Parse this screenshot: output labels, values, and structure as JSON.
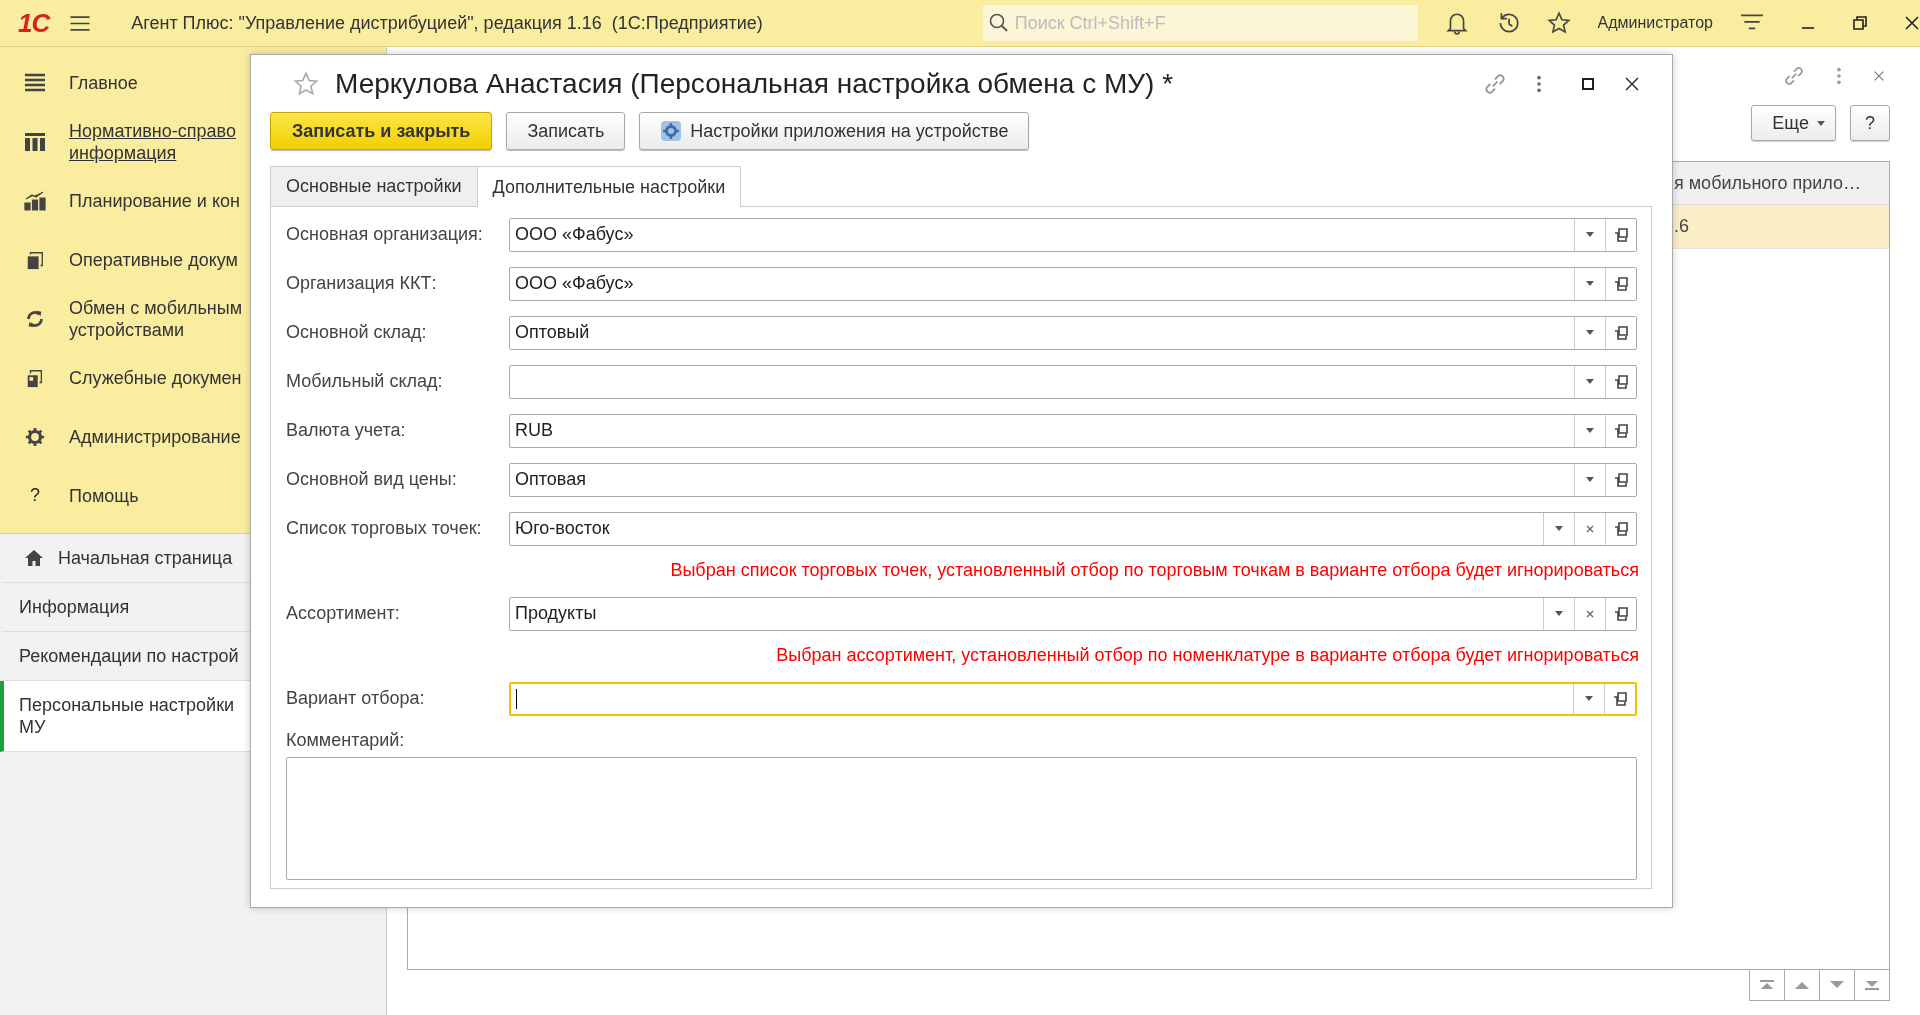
{
  "titlebar": {
    "logo": "1С",
    "title": "Агент Плюс: \"Управление дистрибуцией\", редакция 1.16  (1С:Предприятие)",
    "search": {
      "placeholder": "Поиск Ctrl+Shift+F"
    },
    "user": "Администратор"
  },
  "sidebar": {
    "sections": [
      {
        "lines": [
          "Главное"
        ],
        "kind": "lines",
        "link": false
      },
      {
        "lines": [
          "Нормативно-справо",
          "информация"
        ],
        "kind": "columns",
        "link": true
      },
      {
        "lines": [
          "Планирование и кон"
        ],
        "kind": "chart",
        "link": false
      },
      {
        "lines": [
          "Оперативные докум"
        ],
        "kind": "docs",
        "link": false
      },
      {
        "lines": [
          "Обмен с мобильным",
          "устройствами"
        ],
        "kind": "sync",
        "link": false
      },
      {
        "lines": [
          "Служебные докумен"
        ],
        "kind": "service",
        "link": false
      },
      {
        "lines": [
          "Администрирование"
        ],
        "kind": "gear",
        "link": false
      },
      {
        "lines": [
          "Помощь"
        ],
        "kind": "help",
        "glyph": "?",
        "link": false
      }
    ],
    "open_pages": [
      {
        "lines": [
          "Начальная страница"
        ],
        "kind": "home",
        "selected": false
      },
      {
        "lines": [
          "Информация"
        ],
        "kind": "plain",
        "selected": false
      },
      {
        "lines": [
          "Рекомендации по настрой"
        ],
        "kind": "plain",
        "selected": false
      },
      {
        "lines": [
          "Персональные настройки",
          "МУ"
        ],
        "kind": "plain",
        "selected": true
      }
    ]
  },
  "background_form": {
    "buttons": [
      {
        "label": "Еще",
        "kind": "menu"
      },
      {
        "label": "?",
        "kind": "plain"
      }
    ],
    "table": {
      "columns": [
        "я мобильного прило…"
      ],
      "rows": [
        {
          "cells": [
            ".6"
          ],
          "selected": true
        }
      ]
    }
  },
  "dialog": {
    "title": "Меркулова Анастасия (Персональная настройка обмена с МУ) *",
    "buttons": [
      {
        "label": "Записать и закрыть",
        "kind": "primary"
      },
      {
        "label": "Записать",
        "kind": "default"
      },
      {
        "label": "Настройки приложения на устройстве",
        "kind": "gear"
      }
    ],
    "tabs": [
      {
        "label": "Основные настройки",
        "selected": false
      },
      {
        "label": "Дополнительные настройки",
        "selected": true
      }
    ],
    "fields": [
      {
        "label": "Основная организация:",
        "value": "ООО «Фабус»",
        "clear_button": false,
        "focused": false
      },
      {
        "label": "Организация ККТ:",
        "value": "ООО «Фабус»",
        "clear_button": false,
        "focused": false
      },
      {
        "label": "Основной склад:",
        "value": "Оптовый",
        "clear_button": false,
        "focused": false
      },
      {
        "label": "Мобильный склад:",
        "clear_button": false,
        "focused": false
      },
      {
        "label": "Валюта учета:",
        "value": "RUB",
        "clear_button": false,
        "focused": false
      },
      {
        "label": "Основной вид цены:",
        "value": "Оптовая",
        "clear_button": false,
        "focused": false
      },
      {
        "label": "Список торговых точек:",
        "value": "Юго-восток",
        "clear_button": true,
        "focused": false,
        "warning": "Выбран список торговых точек, установленный отбор по торговым точкам в варианте отбора будет игнорироваться"
      },
      {
        "label": "Ассортимент:",
        "value": "Продукты",
        "clear_button": true,
        "focused": false,
        "warning": "Выбран ассортимент, установленный отбор по номенклатуре в варианте отбора будет игнорироваться"
      },
      {
        "label": "Вариант отбора:",
        "clear_button": false,
        "focused": true
      }
    ],
    "comment": {
      "label": "Комментарий:"
    }
  }
}
